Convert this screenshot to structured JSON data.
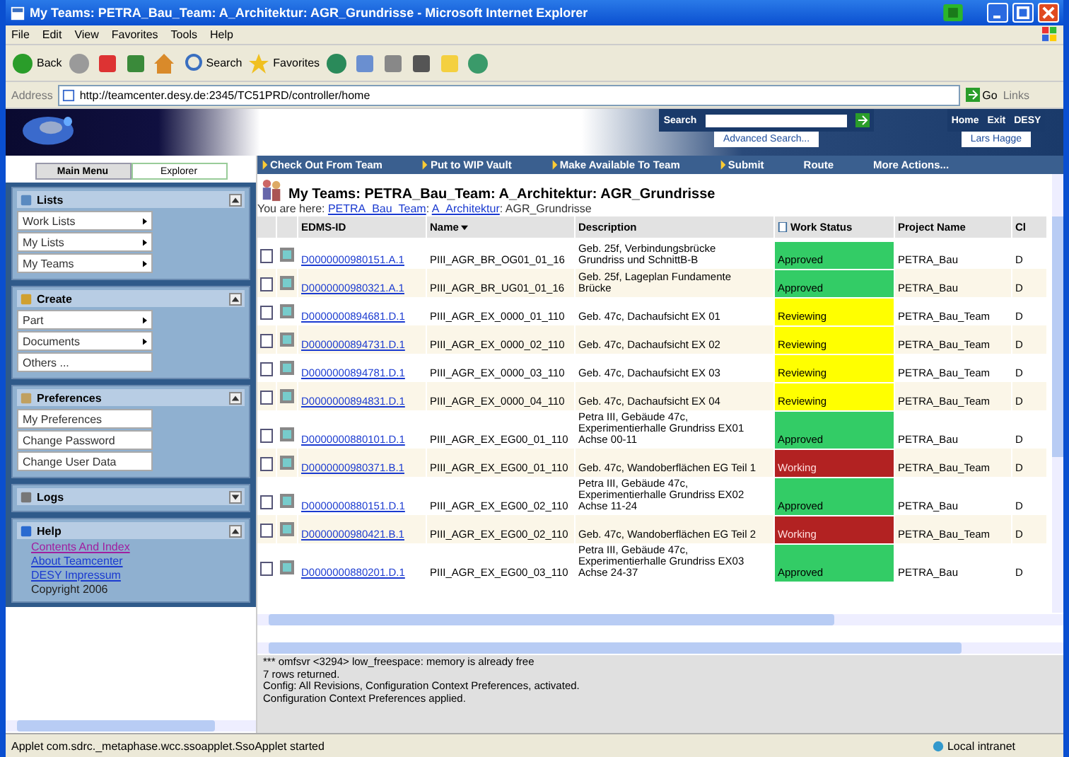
{
  "window": {
    "title": "My Teams: PETRA_Bau_Team: A_Architektur: AGR_Grundrisse - Microsoft Internet Explorer"
  },
  "menu": [
    "File",
    "Edit",
    "View",
    "Favorites",
    "Tools",
    "Help"
  ],
  "toolbar": [
    {
      "kind": "back",
      "label": "Back"
    },
    {
      "kind": "forward"
    },
    {
      "kind": "stop"
    },
    {
      "kind": "refresh"
    },
    {
      "kind": "home"
    },
    {
      "kind": "search",
      "label": "Search"
    },
    {
      "kind": "favorites",
      "label": "Favorites"
    },
    {
      "kind": "history"
    },
    {
      "kind": "mail"
    },
    {
      "kind": "print"
    },
    {
      "kind": "edit"
    },
    {
      "kind": "notes"
    },
    {
      "kind": "messenger"
    }
  ],
  "address": {
    "label": "Address",
    "value": "http://teamcenter.desy.de:2345/TC51PRD/controller/home",
    "go": "Go",
    "links": "Links"
  },
  "banner": {
    "search_label": "Search",
    "advanced": "Advanced Search...",
    "links": [
      "Home",
      "Exit",
      "DESY"
    ],
    "user": "Lars Hagge"
  },
  "nav_tabs": [
    {
      "label": "Main Menu",
      "selected": true
    },
    {
      "label": "Explorer",
      "selected": false
    }
  ],
  "actions": [
    {
      "label": "Check Out From Team",
      "icon": true
    },
    {
      "label": "Put to WIP Vault",
      "icon": true
    },
    {
      "label": "Make Available To Team",
      "icon": true
    },
    {
      "label": "Submit",
      "icon": true
    },
    {
      "label": "Route",
      "icon": false
    },
    {
      "label": "More Actions...",
      "icon": false
    }
  ],
  "sidebar": [
    {
      "title": "Lists",
      "kind": "lists",
      "expanded": true,
      "items": [
        {
          "label": "Work Lists",
          "submenu": true
        },
        {
          "label": "My Lists",
          "submenu": true
        },
        {
          "label": "My Teams",
          "submenu": true
        }
      ]
    },
    {
      "title": "Create",
      "kind": "create",
      "expanded": true,
      "items": [
        {
          "label": "Part",
          "submenu": true
        },
        {
          "label": "Documents",
          "submenu": true
        },
        {
          "label": "Others ...",
          "submenu": false
        }
      ]
    },
    {
      "title": "Preferences",
      "kind": "preferences",
      "expanded": true,
      "items": [
        {
          "label": "My Preferences",
          "submenu": false
        },
        {
          "label": "Change Password",
          "submenu": false
        },
        {
          "label": "Change User Data",
          "submenu": false
        }
      ]
    },
    {
      "title": "Logs",
      "kind": "logs",
      "expanded": false
    },
    {
      "title": "Help",
      "kind": "help",
      "expanded": true,
      "links": [
        {
          "label": "Contents And Index",
          "kind": "visited"
        },
        {
          "label": "About Teamcenter",
          "kind": "link"
        },
        {
          "label": "DESY Impressum",
          "kind": "link"
        },
        {
          "label": "Copyright 2006",
          "kind": "text"
        }
      ]
    }
  ],
  "page": {
    "title": "My Teams: PETRA_Bau_Team: A_Architektur: AGR_Grundrisse",
    "breadcrumb_prefix": "You are here: ",
    "breadcrumb": [
      {
        "text": "PETRA_Bau_Team",
        "link": true
      },
      {
        "text": ": ",
        "link": false
      },
      {
        "text": "A_Architektur",
        "link": true
      },
      {
        "text": ": AGR_Grundrisse",
        "link": false
      }
    ]
  },
  "table": {
    "columns": [
      "EDMS-ID",
      "Name",
      "Description",
      "Work Status",
      "Project Name",
      "Cl"
    ],
    "rows": [
      {
        "checked": false,
        "id": "D0000000980151.A.1",
        "name": "PIII_AGR_BR_OG01_01_16",
        "description": [
          "Geb. 25f, Verbindungsbrücke",
          "Grundriss und SchnittB-B"
        ],
        "status": "Approved",
        "color": "#33cc66",
        "project": "PETRA_Bau",
        "column_7": "D"
      },
      {
        "checked": false,
        "id": "D0000000980321.A.1",
        "name": "PIII_AGR_BR_UG01_01_16",
        "description": [
          "Geb. 25f, Lageplan Fundamente",
          "Brücke"
        ],
        "status": "Approved",
        "color": "#33cc66",
        "project": "PETRA_Bau",
        "column_7": "D"
      },
      {
        "checked": false,
        "id": "D0000000894681.D.1",
        "name": "PIII_AGR_EX_0000_01_110",
        "description": [
          "Geb. 47c, Dachaufsicht EX 01"
        ],
        "status": "Reviewing",
        "color": "#ffff00",
        "project": "PETRA_Bau_Team",
        "column_7": "D"
      },
      {
        "checked": false,
        "id": "D0000000894731.D.1",
        "name": "PIII_AGR_EX_0000_02_110",
        "description": [
          "Geb. 47c, Dachaufsicht EX 02"
        ],
        "status": "Reviewing",
        "color": "#ffff00",
        "project": "PETRA_Bau_Team",
        "column_7": "D"
      },
      {
        "checked": false,
        "id": "D0000000894781.D.1",
        "name": "PIII_AGR_EX_0000_03_110",
        "description": [
          "Geb. 47c, Dachaufsicht EX 03"
        ],
        "status": "Reviewing",
        "color": "#ffff00",
        "project": "PETRA_Bau_Team",
        "column_7": "D"
      },
      {
        "checked": false,
        "id": "D0000000894831.D.1",
        "name": "PIII_AGR_EX_0000_04_110",
        "description": [
          "Geb. 47c, Dachaufsicht EX 04"
        ],
        "status": "Reviewing",
        "color": "#ffff00",
        "project": "PETRA_Bau_Team",
        "column_7": "D"
      },
      {
        "checked": false,
        "id": "D0000000880101.D.1",
        "name": "PIII_AGR_EX_EG00_01_110",
        "description": [
          "Petra III, Gebäude 47c,",
          "Experimentierhalle Grundriss EX01",
          "Achse 00-11"
        ],
        "status": "Approved",
        "color": "#33cc66",
        "project": "PETRA_Bau",
        "column_7": "D"
      },
      {
        "checked": false,
        "id": "D0000000980371.B.1",
        "name": "PIII_AGR_EX_EG00_01_110",
        "description": [
          "Geb. 47c, Wandoberflächen EG Teil 1"
        ],
        "status": "Working",
        "color": "#b22222",
        "project": "PETRA_Bau_Team",
        "column_7": "D"
      },
      {
        "checked": false,
        "id": "D0000000880151.D.1",
        "name": "PIII_AGR_EX_EG00_02_110",
        "description": [
          "Petra III, Gebäude 47c,",
          "Experimentierhalle Grundriss EX02",
          "Achse 11-24"
        ],
        "status": "Approved",
        "color": "#33cc66",
        "project": "PETRA_Bau",
        "column_7": "D"
      },
      {
        "checked": false,
        "id": "D0000000980421.B.1",
        "name": "PIII_AGR_EX_EG00_02_110",
        "description": [
          "Geb. 47c, Wandoberflächen EG Teil 2"
        ],
        "status": "Working",
        "color": "#b22222",
        "project": "PETRA_Bau_Team",
        "column_7": "D"
      },
      {
        "checked": false,
        "id": "D0000000880201.D.1",
        "name": "PIII_AGR_EX_EG00_03_110",
        "description": [
          "Petra III, Gebäude 47c,",
          "Experimentierhalle Grundriss EX03",
          "Achse 24-37"
        ],
        "status": "Approved",
        "color": "#33cc66",
        "project": "PETRA_Bau",
        "column_7": "D"
      }
    ]
  },
  "log": [
    "*** omfsvr <3294> low_freespace: memory is already free",
    "7 rows returned.",
    "Config: All Revisions, Configuration Context Preferences, activated.",
    "Configuration Context Preferences applied."
  ],
  "status_bar": {
    "text": "Applet com.sdrc._metaphase.wcc.ssoapplet.SsoApplet started",
    "zone": "Local intranet"
  }
}
